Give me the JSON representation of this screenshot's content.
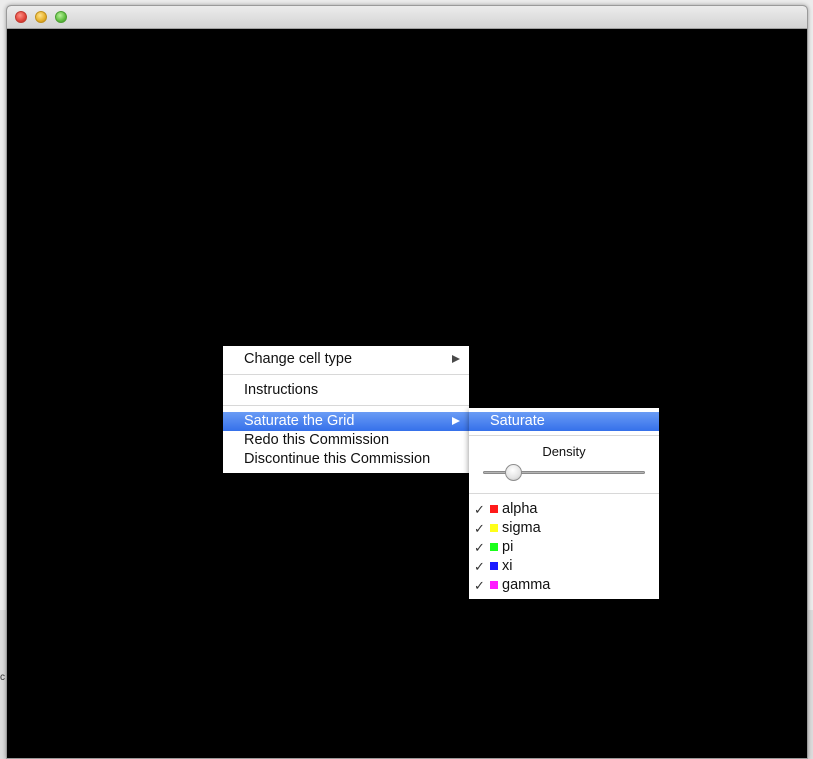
{
  "window": {
    "title": ""
  },
  "side_text": "c",
  "context_menu": {
    "items": [
      {
        "label": "Change cell type",
        "has_submenu": true,
        "selected": false
      },
      {
        "label": "Instructions",
        "has_submenu": false,
        "selected": false
      },
      {
        "label": "Saturate the Grid",
        "has_submenu": true,
        "selected": true
      },
      {
        "label": "Redo this Commission",
        "has_submenu": false,
        "selected": false
      },
      {
        "label": "Discontinue this Commission",
        "has_submenu": false,
        "selected": false
      }
    ]
  },
  "saturate_submenu": {
    "saturate_label": "Saturate",
    "density_label": "Density",
    "density_value": 0.15,
    "cell_types": [
      {
        "label": "alpha",
        "checked": true,
        "color": "#ff1a1a"
      },
      {
        "label": "sigma",
        "checked": true,
        "color": "#ffff1a"
      },
      {
        "label": "pi",
        "checked": true,
        "color": "#1aff1a"
      },
      {
        "label": "xi",
        "checked": true,
        "color": "#1a1aff"
      },
      {
        "label": "gamma",
        "checked": true,
        "color": "#ff1aff"
      }
    ],
    "check_glyph": "✓"
  }
}
